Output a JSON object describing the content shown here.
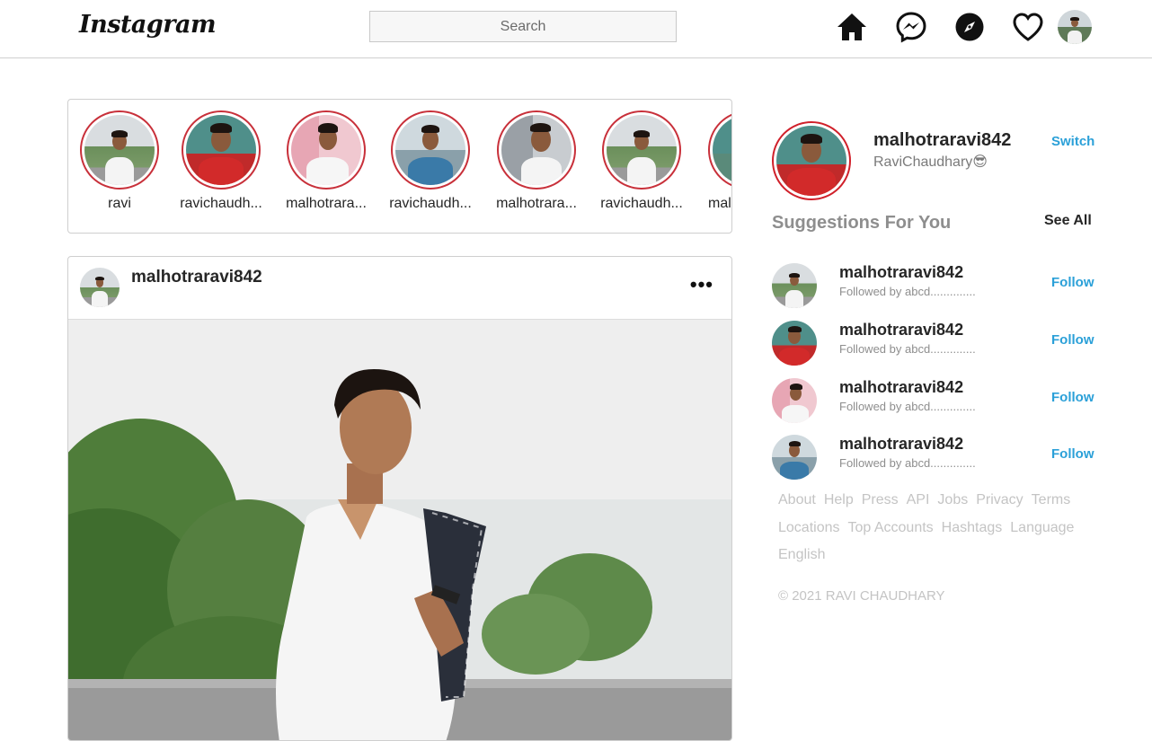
{
  "nav": {
    "logo": "Instagram",
    "search_placeholder": "Search",
    "icons": [
      "home-icon",
      "messenger-icon",
      "explore-icon",
      "heart-icon",
      "profile-avatar"
    ]
  },
  "stories": [
    {
      "name": "ravi"
    },
    {
      "name": "ravichaudh..."
    },
    {
      "name": "malhotrara..."
    },
    {
      "name": "ravichaudh..."
    },
    {
      "name": "malhotrara..."
    },
    {
      "name": "ravichaudh..."
    },
    {
      "name": "mal"
    }
  ],
  "post": {
    "username": "malhotraravi842",
    "more_label": "•••"
  },
  "sidebar": {
    "username": "malhotraravi842",
    "fullname": "RaviChaudhary😎",
    "switch_label": "Switch",
    "suggestions_title": "Suggestions For You",
    "see_all_label": "See All",
    "suggestions": [
      {
        "username": "malhotraravi842",
        "subtitle": "Followed by abcd..............",
        "action": "Follow"
      },
      {
        "username": "malhotraravi842",
        "subtitle": "Followed by abcd..............",
        "action": "Follow"
      },
      {
        "username": "malhotraravi842",
        "subtitle": "Followed by abcd..............",
        "action": "Follow"
      },
      {
        "username": "malhotraravi842",
        "subtitle": "Followed by abcd..............",
        "action": "Follow"
      }
    ],
    "footer_links": [
      "About",
      "Help",
      "Press",
      "API",
      "Jobs",
      "Privacy",
      "Terms",
      "Locations",
      "Top Accounts",
      "Hashtags",
      "Language",
      "English"
    ],
    "copyright": "© 2021 RAVI CHAUDHARY"
  },
  "colors": {
    "accent": "#2ba0d8",
    "story_ring": "#c8303a",
    "border": "#cfcfcf",
    "muted": "#8e8e8e"
  }
}
